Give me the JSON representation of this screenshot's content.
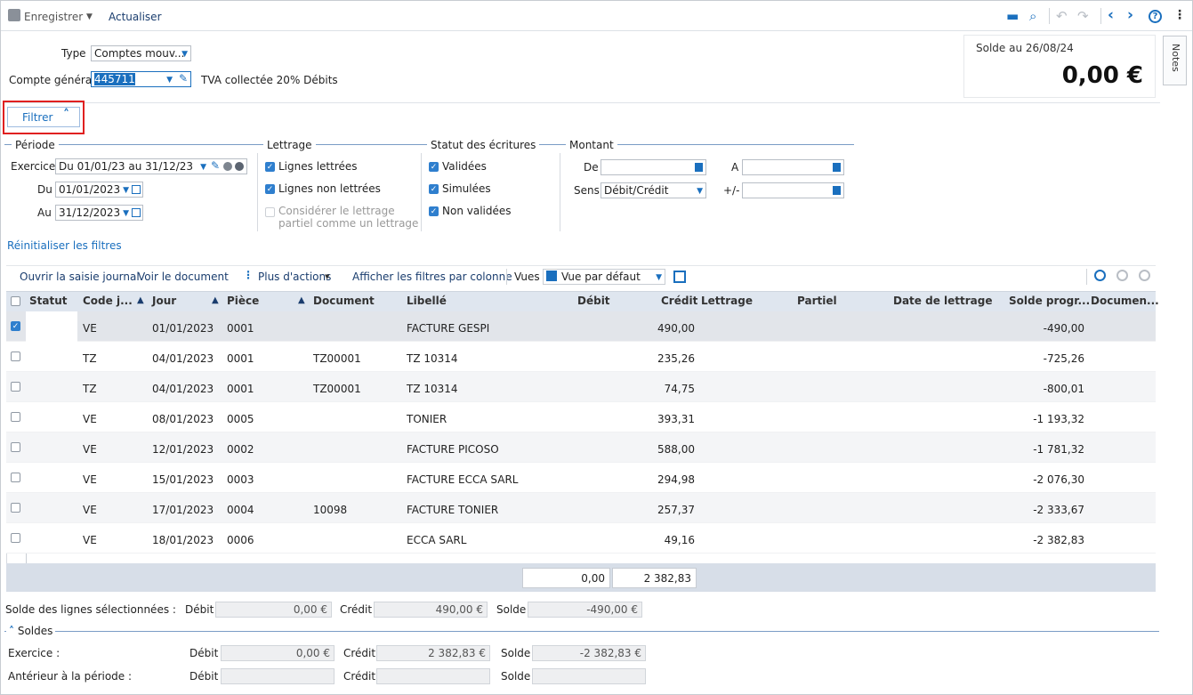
{
  "toolbar": {
    "save_label": "Enregistrer",
    "refresh_label": "Actualiser"
  },
  "header": {
    "type_label": "Type",
    "type_value": "Comptes mouv...",
    "account_label": "Compte général",
    "account_value": "445711",
    "account_desc": "TVA collectée 20% Débits",
    "balance_label": "Solde au 26/08/24",
    "balance_value": "0,00 €",
    "notes_label": "Notes"
  },
  "filter": {
    "toggle_label": "Filtrer",
    "periode": {
      "title": "Période",
      "exercice_label": "Exercice",
      "exercice_value": "Du 01/01/23 au 31/12/23",
      "du_label": "Du",
      "du_value": "01/01/2023",
      "au_label": "Au",
      "au_value": "31/12/2023"
    },
    "lettrage": {
      "title": "Lettrage",
      "opt1": "Lignes lettrées",
      "opt2": "Lignes non lettrées",
      "opt3": "Considérer le lettrage partiel comme un lettrage",
      "opt1_checked": true,
      "opt2_checked": true,
      "opt3_checked": false
    },
    "statut": {
      "title": "Statut des écritures",
      "opt1": "Validées",
      "opt2": "Simulées",
      "opt3": "Non validées"
    },
    "montant": {
      "title": "Montant",
      "de_label": "De",
      "a_label": "A",
      "sens_label": "Sens",
      "sens_value": "Débit/Crédit",
      "plusminus_label": "+/-"
    },
    "reset_label": "Réinitialiser les filtres"
  },
  "grid_toolbar": {
    "open_journal": "Ouvrir la saisie journal",
    "view_doc": "Voir le document",
    "more_actions": "Plus d'actions",
    "show_filters": "Afficher les filtres par colonne",
    "views_label": "Vues",
    "view_value": "Vue par défaut"
  },
  "table": {
    "columns": {
      "statut": "Statut",
      "code": "Code j...",
      "jour": "Jour",
      "piece": "Pièce",
      "document": "Document",
      "libelle": "Libellé",
      "debit": "Débit",
      "credit": "Crédit",
      "lettrage": "Lettrage",
      "partiel": "Partiel",
      "date_lettrage": "Date de lettrage",
      "solde": "Solde progr...",
      "documen": "Documen..."
    },
    "rows": [
      {
        "code": "VE",
        "jour": "01/01/2023",
        "piece": "0001",
        "document": "",
        "libelle": "FACTURE GESPI",
        "debit": "",
        "credit": "490,00",
        "solde": "-490,00",
        "checked": true
      },
      {
        "code": "TZ",
        "jour": "04/01/2023",
        "piece": "0001",
        "document": "TZ00001",
        "libelle": "TZ 10314",
        "debit": "",
        "credit": "235,26",
        "solde": "-725,26",
        "checked": false
      },
      {
        "code": "TZ",
        "jour": "04/01/2023",
        "piece": "0001",
        "document": "TZ00001",
        "libelle": "TZ 10314",
        "debit": "",
        "credit": "74,75",
        "solde": "-800,01",
        "checked": false
      },
      {
        "code": "VE",
        "jour": "08/01/2023",
        "piece": "0005",
        "document": "",
        "libelle": "TONIER",
        "debit": "",
        "credit": "393,31",
        "solde": "-1 193,32",
        "checked": false
      },
      {
        "code": "VE",
        "jour": "12/01/2023",
        "piece": "0002",
        "document": "",
        "libelle": "FACTURE PICOSO",
        "debit": "",
        "credit": "588,00",
        "solde": "-1 781,32",
        "checked": false
      },
      {
        "code": "VE",
        "jour": "15/01/2023",
        "piece": "0003",
        "document": "",
        "libelle": "FACTURE ECCA SARL",
        "debit": "",
        "credit": "294,98",
        "solde": "-2 076,30",
        "checked": false
      },
      {
        "code": "VE",
        "jour": "17/01/2023",
        "piece": "0004",
        "document": "10098",
        "libelle": "FACTURE TONIER",
        "debit": "",
        "credit": "257,37",
        "solde": "-2 333,67",
        "checked": false
      },
      {
        "code": "VE",
        "jour": "18/01/2023",
        "piece": "0006",
        "document": "",
        "libelle": "ECCA SARL",
        "debit": "",
        "credit": "49,16",
        "solde": "-2 382,83",
        "checked": false
      }
    ],
    "total_debit": "0,00",
    "total_credit": "2 382,83"
  },
  "selection": {
    "label": "Solde des lignes sélectionnées :",
    "debit_label": "Débit",
    "debit_value": "0,00 €",
    "credit_label": "Crédit",
    "credit_value": "490,00 €",
    "solde_label": "Solde",
    "solde_value": "-490,00 €"
  },
  "soldes": {
    "title": "Soldes",
    "exercice_label": "Exercice :",
    "exercice_debit": "0,00 €",
    "exercice_credit": "2 382,83 €",
    "exercice_solde": "-2 382,83 €",
    "anterieur_label": "Antérieur à la période :",
    "anterieur_debit": "",
    "anterieur_credit": "",
    "anterieur_solde": "",
    "debit_label": "Débit",
    "credit_label": "Crédit",
    "solde_label": "Solde"
  },
  "colors": {
    "accent": "#1a6fbe",
    "highlight_box": "#e02020",
    "grid_header": "#dfe6ef",
    "footer_band": "#d7dee8"
  }
}
